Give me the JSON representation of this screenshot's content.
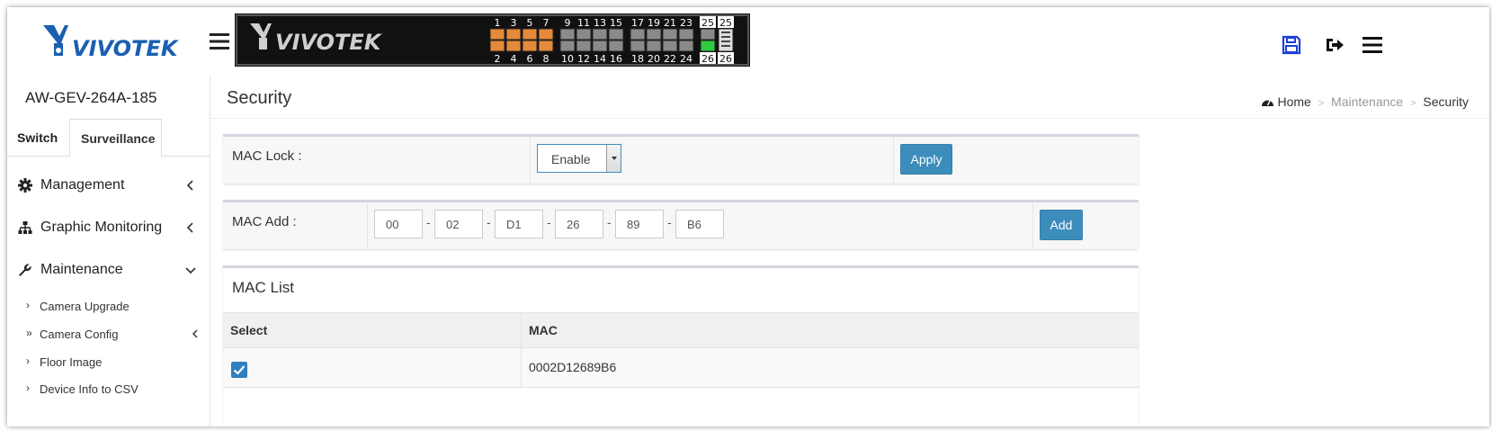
{
  "brand": {
    "name": "VIVOTEK",
    "logo_color": "#1b5fb0"
  },
  "switch_panel": {
    "model_text": "VIVOTEK",
    "top_port_labels": [
      "1",
      "3",
      "5",
      "7",
      "9",
      "11",
      "13",
      "15",
      "17",
      "19",
      "21",
      "23",
      "25",
      "25"
    ],
    "bottom_port_labels": [
      "2",
      "4",
      "6",
      "8",
      "10",
      "12",
      "14",
      "16",
      "18",
      "20",
      "22",
      "24",
      "26",
      "26"
    ],
    "active_ports_color": "#e58a3a",
    "inactive_ports_color": "#8a8a8a",
    "link_up_color": "#2ecc40"
  },
  "toolbar": {
    "save_icon": "save-icon",
    "logout_icon": "logout-icon",
    "menu_icon": "menu-icon"
  },
  "sidebar": {
    "device_name": "AW-GEV-264A-185",
    "tabs": [
      {
        "label": "Switch"
      },
      {
        "label": "Surveillance"
      }
    ],
    "nav": [
      {
        "label": "Management",
        "icon": "gear-icon"
      },
      {
        "label": "Graphic Monitoring",
        "icon": "sitemap-icon"
      },
      {
        "label": "Maintenance",
        "icon": "wrench-icon"
      }
    ],
    "sub_items": [
      {
        "label": "Camera Upgrade",
        "mark": "›"
      },
      {
        "label": "Camera Config",
        "mark": "»"
      },
      {
        "label": "Floor Image",
        "mark": "›"
      },
      {
        "label": "Device Info to CSV",
        "mark": "›"
      }
    ]
  },
  "page": {
    "title": "Security",
    "breadcrumb": {
      "home": "Home",
      "parent": "Maintenance",
      "current": "Security",
      "sep": ">"
    }
  },
  "mac_lock": {
    "label": "MAC Lock :",
    "value": "Enable",
    "apply_label": "Apply"
  },
  "mac_add": {
    "label": "MAC Add :",
    "octets": [
      "00",
      "02",
      "D1",
      "26",
      "89",
      "B6"
    ],
    "separator": "-",
    "add_label": "Add"
  },
  "mac_list": {
    "title": "MAC List",
    "columns": [
      "Select",
      "MAC"
    ],
    "rows": [
      {
        "selected": true,
        "mac": "0002D12689B6"
      }
    ]
  },
  "colors": {
    "primary_button": "#3c8dbc",
    "checkbox": "#2f7fc1"
  }
}
